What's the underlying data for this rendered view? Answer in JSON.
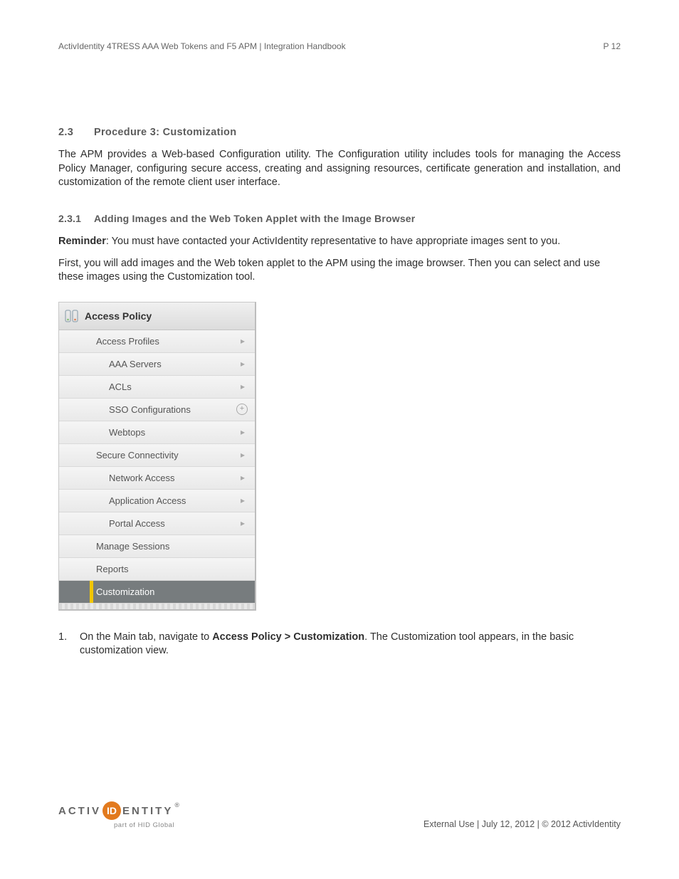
{
  "header": {
    "doc_title": "ActivIdentity 4TRESS AAA Web Tokens and F5 APM | Integration Handbook",
    "page_label": "P 12"
  },
  "section": {
    "num": "2.3",
    "title": "Procedure 3: Customization",
    "intro": "The APM provides a Web-based Configuration utility. The Configuration utility includes tools for managing the Access Policy Manager, configuring secure access, creating and assigning resources, certificate generation and installation, and customization of the remote client user interface."
  },
  "subsection": {
    "num": "2.3.1",
    "title": "Adding Images and the Web Token Applet with the Image Browser",
    "reminder_label": "Reminder",
    "reminder_text": ": You must have contacted your ActivIdentity representative to have appropriate images sent to you.",
    "intro2": "First, you will add images and the Web token applet to the APM using the image browser. Then you can select and use these images using the Customization tool."
  },
  "menu": {
    "title": "Access Policy",
    "items": [
      {
        "label": "Access Profiles",
        "indent": 1,
        "icon": "chevron"
      },
      {
        "label": "AAA Servers",
        "indent": 2,
        "icon": "chevron"
      },
      {
        "label": "ACLs",
        "indent": 2,
        "icon": "chevron"
      },
      {
        "label": "SSO Configurations",
        "indent": 2,
        "icon": "plus"
      },
      {
        "label": "Webtops",
        "indent": 2,
        "icon": "chevron"
      },
      {
        "label": "Secure Connectivity",
        "indent": 1,
        "icon": "chevron"
      },
      {
        "label": "Network Access",
        "indent": 2,
        "icon": "chevron"
      },
      {
        "label": "Application Access",
        "indent": 2,
        "icon": "chevron"
      },
      {
        "label": "Portal Access",
        "indent": 2,
        "icon": "chevron"
      },
      {
        "label": "Manage Sessions",
        "indent": 1,
        "icon": ""
      },
      {
        "label": "Reports",
        "indent": 1,
        "icon": ""
      },
      {
        "label": "Customization",
        "indent": 1,
        "icon": "",
        "selected": true
      }
    ]
  },
  "step": {
    "num": "1.",
    "pre": "On the Main tab, navigate to ",
    "bold": "Access Policy > Customization",
    "post": ". The Customization tool appears, in the basic customization view."
  },
  "footer": {
    "right": "External Use | July 12, 2012 | © 2012 ActivIdentity",
    "logo_left": "ACTIV",
    "logo_mid": "ID",
    "logo_right": "ENTITY",
    "logo_reg": "®",
    "logo_sub": "part of HID Global"
  }
}
